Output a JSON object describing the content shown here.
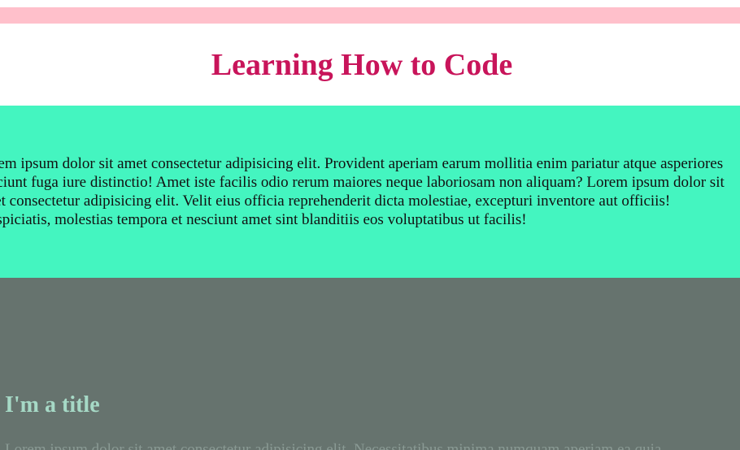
{
  "colors": {
    "top_bar": "#ffc0cb",
    "title": "#c8145a",
    "hero_bg": "#44f5c0",
    "section_bg": "#66736e",
    "section_title": "#a6d9c6",
    "section_text": "#8a9a94"
  },
  "header": {
    "title": "Learning How to Code"
  },
  "hero": {
    "lines": [
      "Lorem ipsum dolor sit amet consectetur adipisicing elit. Provident aperiam earum mollitia enim pariatur atque asperiores",
      "nesciunt fuga iure distinctio! Amet iste facilis odio rerum maiores neque laboriosam non aliquam? Lorem ipsum dolor sit",
      "amet consectetur adipisicing elit. Velit eius officia reprehenderit dicta molestiae, excepturi inventore aut officiis!",
      "Perspiciatis, molestias tempora et nesciunt amet sint blanditiis eos voluptatibus ut facilis!"
    ]
  },
  "section": {
    "title": "I'm a title",
    "text": "Lorem ipsum dolor sit amet consectetur adipisicing elit. Necessitatibus minima numquam aperiam ea quia"
  }
}
